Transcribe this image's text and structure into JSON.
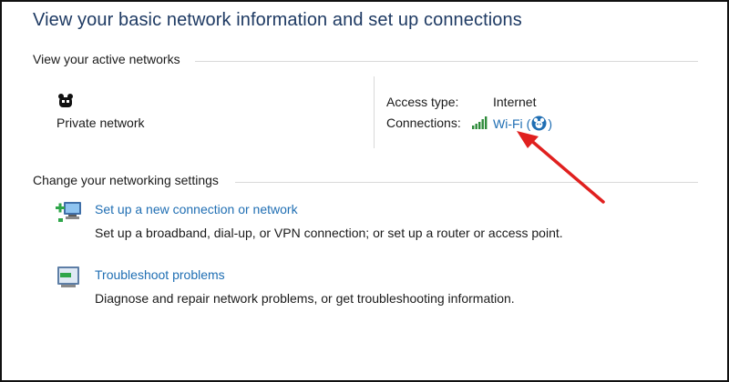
{
  "header": {
    "title": "View your basic network information and set up connections"
  },
  "active_networks": {
    "section_label": "View your active networks",
    "network": {
      "icon": "network-bench-icon",
      "name": "Private network",
      "access_type_label": "Access type:",
      "access_type_value": "Internet",
      "connections_label": "Connections:",
      "signal_icon": "wifi-signal-bars-icon",
      "connection_name": "Wi-Fi",
      "connection_open_paren": "(",
      "connection_close_paren": ")",
      "connection_avatar_icon": "network-avatar-icon"
    }
  },
  "settings": {
    "section_label": "Change your networking settings",
    "tasks": [
      {
        "icon": "new-connection-icon",
        "link": "Set up a new connection or network",
        "description": "Set up a broadband, dial-up, or VPN connection; or set up a router or access point."
      },
      {
        "icon": "troubleshoot-icon",
        "link": "Troubleshoot problems",
        "description": "Diagnose and repair network problems, or get troubleshooting information."
      }
    ]
  },
  "colors": {
    "title": "#1e3a63",
    "link": "#1f6eb3",
    "arrow": "#e0201f",
    "rule": "#d9d9d9"
  }
}
